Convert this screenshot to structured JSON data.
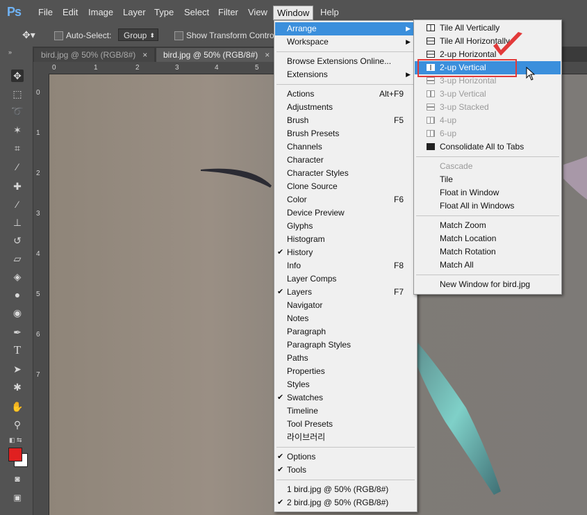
{
  "app": {
    "logo": "Ps"
  },
  "menubar": [
    "File",
    "Edit",
    "Image",
    "Layer",
    "Type",
    "Select",
    "Filter",
    "View",
    "Window",
    "Help"
  ],
  "options": {
    "autoselect_label": "Auto-Select:",
    "group_value": "Group",
    "show_transform_label": "Show Transform Controls"
  },
  "tabs": [
    {
      "label": "bird.jpg @ 50% (RGB/8#)",
      "close": "×"
    },
    {
      "label": "bird.jpg @ 50% (RGB/8#)",
      "close": "×"
    }
  ],
  "ruler_h": [
    "0",
    "1",
    "2",
    "3",
    "4",
    "5"
  ],
  "ruler_v": [
    "0",
    "1",
    "2",
    "3",
    "4",
    "5",
    "6",
    "7"
  ],
  "window_menu": [
    {
      "label": "Arrange",
      "submenu": true,
      "highlighted": true
    },
    {
      "label": "Workspace",
      "submenu": true
    },
    {
      "sep": true
    },
    {
      "label": "Browse Extensions Online..."
    },
    {
      "label": "Extensions",
      "submenu": true
    },
    {
      "sep": true
    },
    {
      "label": "Actions",
      "shortcut": "Alt+F9"
    },
    {
      "label": "Adjustments"
    },
    {
      "label": "Brush",
      "shortcut": "F5"
    },
    {
      "label": "Brush Presets"
    },
    {
      "label": "Channels"
    },
    {
      "label": "Character"
    },
    {
      "label": "Character Styles"
    },
    {
      "label": "Clone Source"
    },
    {
      "label": "Color",
      "shortcut": "F6"
    },
    {
      "label": "Device Preview"
    },
    {
      "label": "Glyphs"
    },
    {
      "label": "Histogram"
    },
    {
      "label": "History",
      "checked": true
    },
    {
      "label": "Info",
      "shortcut": "F8"
    },
    {
      "label": "Layer Comps"
    },
    {
      "label": "Layers",
      "shortcut": "F7",
      "checked": true
    },
    {
      "label": "Navigator"
    },
    {
      "label": "Notes"
    },
    {
      "label": "Paragraph"
    },
    {
      "label": "Paragraph Styles"
    },
    {
      "label": "Paths"
    },
    {
      "label": "Properties"
    },
    {
      "label": "Styles"
    },
    {
      "label": "Swatches",
      "checked": true
    },
    {
      "label": "Timeline"
    },
    {
      "label": "Tool Presets"
    },
    {
      "label": "라이브러리"
    },
    {
      "sep": true
    },
    {
      "label": "Options",
      "checked": true
    },
    {
      "label": "Tools",
      "checked": true
    },
    {
      "sep": true
    },
    {
      "label": "1 bird.jpg @ 50% (RGB/8#)"
    },
    {
      "label": "2 bird.jpg @ 50% (RGB/8#)",
      "checked": true
    }
  ],
  "arrange_menu": [
    {
      "label": "Tile All Vertically",
      "icon": "tile-vertical-icon"
    },
    {
      "label": "Tile All Horizontally",
      "icon": "tile-horizontal-icon"
    },
    {
      "label": "2-up Horizontal",
      "icon": "two-up-horizontal-icon"
    },
    {
      "label": "2-up Vertical",
      "icon": "two-up-vertical-icon",
      "highlighted": true
    },
    {
      "label": "3-up Horizontal",
      "icon": "three-up-horizontal-icon",
      "disabled": true
    },
    {
      "label": "3-up Vertical",
      "icon": "three-up-vertical-icon",
      "disabled": true
    },
    {
      "label": "3-up Stacked",
      "icon": "three-up-stacked-icon",
      "disabled": true
    },
    {
      "label": "4-up",
      "icon": "four-up-icon",
      "disabled": true
    },
    {
      "label": "6-up",
      "icon": "six-up-icon",
      "disabled": true
    },
    {
      "label": "Consolidate All to Tabs",
      "icon": "consolidate-tabs-icon"
    },
    {
      "sep": true
    },
    {
      "label": "Cascade",
      "disabled": true
    },
    {
      "label": "Tile"
    },
    {
      "label": "Float in Window"
    },
    {
      "label": "Float All in Windows"
    },
    {
      "sep": true
    },
    {
      "label": "Match Zoom"
    },
    {
      "label": "Match Location"
    },
    {
      "label": "Match Rotation"
    },
    {
      "label": "Match All"
    },
    {
      "sep": true
    },
    {
      "label": "New Window for bird.jpg"
    }
  ],
  "colors": {
    "highlight": "#3b8fdc",
    "annotation_red": "#e23a3a",
    "foreground": "#e02020",
    "background": "#ffffff"
  }
}
